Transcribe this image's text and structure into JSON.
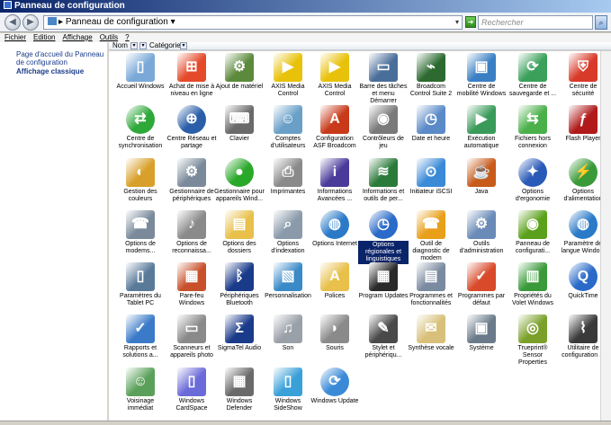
{
  "window": {
    "title": "Panneau de configuration"
  },
  "address": {
    "path": "Panneau de configuration",
    "search_placeholder": "Rechercher"
  },
  "menu": [
    "Fichier",
    "Edition",
    "Affichage",
    "Outils",
    "?"
  ],
  "left_pane": {
    "home_link": "Page d'accueil du Panneau de configuration",
    "classic_view": "Affichage classique"
  },
  "columns": {
    "name": "Nom",
    "category": "Catégorie"
  },
  "items": [
    {
      "label": "Accueil Windows",
      "icon": "accueil-windows-icon",
      "color": "#7aa9d8"
    },
    {
      "label": "Achat de mise à niveau en ligne",
      "icon": "windows-flag-icon",
      "color": "#e44a2a"
    },
    {
      "label": "Ajout de matériel",
      "icon": "hardware-icon",
      "color": "#5c8a3c"
    },
    {
      "label": "AXIS Media Control",
      "icon": "axis-media-icon",
      "color": "#e8c20a"
    },
    {
      "label": "AXIS Media Control",
      "icon": "axis-media-icon",
      "color": "#e8c20a"
    },
    {
      "label": "Barre des tâches et menu Démarrer",
      "icon": "taskbar-icon",
      "color": "#4a6e9a"
    },
    {
      "label": "Broadcom Control Suite 2",
      "icon": "broadcom-icon",
      "color": "#2c6a30"
    },
    {
      "label": "Centre de mobilité Windows",
      "icon": "mobility-icon",
      "color": "#3a7fc4"
    },
    {
      "label": "Centre de sauvegarde et ...",
      "icon": "backup-icon",
      "color": "#3aa05a"
    },
    {
      "label": "Centre de sécurité",
      "icon": "security-shield-icon",
      "color": "#d83a2a"
    },
    {
      "label": "Centre de synchronisation",
      "icon": "sync-icon",
      "color": "#2fa83a"
    },
    {
      "label": "Centre Réseau et partage",
      "icon": "network-icon",
      "color": "#2a5ea8"
    },
    {
      "label": "Clavier",
      "icon": "keyboard-icon",
      "color": "#6a6a6a"
    },
    {
      "label": "Comptes d'utilisateurs",
      "icon": "users-icon",
      "color": "#6aa0c8"
    },
    {
      "label": "Configuration ASF Broadcom",
      "icon": "asf-icon",
      "color": "#c83a1a"
    },
    {
      "label": "Contrôleurs de jeu",
      "icon": "gamepad-icon",
      "color": "#7a7a7a"
    },
    {
      "label": "Date et heure",
      "icon": "calendar-icon",
      "color": "#5a8ac8"
    },
    {
      "label": "Exécution automatique",
      "icon": "autoplay-icon",
      "color": "#3a9a5a"
    },
    {
      "label": "Fichiers hors connexion",
      "icon": "offline-files-icon",
      "color": "#4ab04a"
    },
    {
      "label": "Flash Player",
      "icon": "flash-icon",
      "color": "#b01a1a"
    },
    {
      "label": "Gestion des couleurs",
      "icon": "color-management-icon",
      "color": "#d8a02a"
    },
    {
      "label": "Gestionnaire de périphériques",
      "icon": "device-manager-icon",
      "color": "#7a8a9a"
    },
    {
      "label": "Gestionnaire pour appareils Wind...",
      "icon": "green-orb-icon",
      "color": "#2aa82a"
    },
    {
      "label": "Imprimantes",
      "icon": "printer-icon",
      "color": "#8a8a8a"
    },
    {
      "label": "Informations Avancées ...",
      "icon": "intel-icon",
      "color": "#4a3a9a"
    },
    {
      "label": "Informations et outils de per...",
      "icon": "performance-icon",
      "color": "#2a7a3a"
    },
    {
      "label": "Initiateur iSCSI",
      "icon": "iscsi-icon",
      "color": "#3a8ad8"
    },
    {
      "label": "Java",
      "icon": "java-icon",
      "color": "#c85a1a"
    },
    {
      "label": "Options d'ergonomie",
      "icon": "ergonomics-icon",
      "color": "#2a5ab8"
    },
    {
      "label": "Options d'alimentation",
      "icon": "power-icon",
      "color": "#3a9a3a"
    },
    {
      "label": "Options de modems...",
      "icon": "phone-icon",
      "color": "#7a8a9a"
    },
    {
      "label": "Options de reconnaissa...",
      "icon": "microphone-icon",
      "color": "#8a8a8a"
    },
    {
      "label": "Options des dossiers",
      "icon": "folder-icon",
      "color": "#e8c04a"
    },
    {
      "label": "Options d'indexation",
      "icon": "indexing-icon",
      "color": "#8a9aaa"
    },
    {
      "label": "Options Internet",
      "icon": "internet-icon",
      "color": "#2a7ac8"
    },
    {
      "label": "Options régionales et linguistiques",
      "icon": "regional-icon",
      "color": "#2a6ac8"
    },
    {
      "label": "Outil de diagnostic de modem",
      "icon": "modem-diagnostic-icon",
      "color": "#e8a01a"
    },
    {
      "label": "Outils d'administration",
      "icon": "admin-tools-icon",
      "color": "#6a8ab8"
    },
    {
      "label": "Panneau de configurati...",
      "icon": "nvidia-icon",
      "color": "#5aa01a"
    },
    {
      "label": "Paramètre de langue Windo...",
      "icon": "language-icon",
      "color": "#2a7ac8"
    },
    {
      "label": "Paramètres du Tablet PC",
      "icon": "tablet-icon",
      "color": "#5a7a9a"
    },
    {
      "label": "Pare-feu Windows",
      "icon": "firewall-icon",
      "color": "#c8502a"
    },
    {
      "label": "Périphériques Bluetooth",
      "icon": "bluetooth-icon",
      "color": "#1a3a8a"
    },
    {
      "label": "Personnalisation",
      "icon": "personalization-icon",
      "color": "#3a8ac8"
    },
    {
      "label": "Polices",
      "icon": "fonts-icon",
      "color": "#e8c04a"
    },
    {
      "label": "Program Updates",
      "icon": "program-updates-icon",
      "color": "#2a2a2a"
    },
    {
      "label": "Programmes et fonctionnalités",
      "icon": "programs-icon",
      "color": "#7a8aa0"
    },
    {
      "label": "Programmes par défaut",
      "icon": "default-programs-icon",
      "color": "#d84a2a"
    },
    {
      "label": "Propriétés du Volet Windows",
      "icon": "sidebar-icon",
      "color": "#3a9a3a"
    },
    {
      "label": "QuickTime",
      "icon": "quicktime-icon",
      "color": "#2a6ac8"
    },
    {
      "label": "Rapports et solutions a...",
      "icon": "reports-icon",
      "color": "#3a7ac8"
    },
    {
      "label": "Scanneurs et appareils photo",
      "icon": "scanner-icon",
      "color": "#8a8a8a"
    },
    {
      "label": "SigmaTel Audio",
      "icon": "sigmatel-icon",
      "color": "#1a3a8a"
    },
    {
      "label": "Son",
      "icon": "speaker-icon",
      "color": "#9aa0a8"
    },
    {
      "label": "Souris",
      "icon": "mouse-icon",
      "color": "#8a8a8a"
    },
    {
      "label": "Stylet et périphériqu...",
      "icon": "pen-icon",
      "color": "#4a4a4a"
    },
    {
      "label": "Synthèse vocale",
      "icon": "speech-icon",
      "color": "#d8c07a"
    },
    {
      "label": "Système",
      "icon": "system-icon",
      "color": "#6a7a8a"
    },
    {
      "label": "Trueprint® Sensor Properties",
      "icon": "fingerprint-icon",
      "color": "#7aa02a"
    },
    {
      "label": "Utilitaire de configuration ...",
      "icon": "wireless-icon",
      "color": "#3a3a3a"
    },
    {
      "label": "Voisinage immédiat",
      "icon": "people-near-me-icon",
      "color": "#5aa05a"
    },
    {
      "label": "Windows CardSpace",
      "icon": "cardspace-icon",
      "color": "#6a6ad8"
    },
    {
      "label": "Windows Defender",
      "icon": "defender-icon",
      "color": "#6a6a6a"
    },
    {
      "label": "Windows SideShow",
      "icon": "sideshow-icon",
      "color": "#3aa0d8"
    },
    {
      "label": "Windows Update",
      "icon": "windows-update-icon",
      "color": "#3a8ad8"
    }
  ],
  "selected_index": 35
}
